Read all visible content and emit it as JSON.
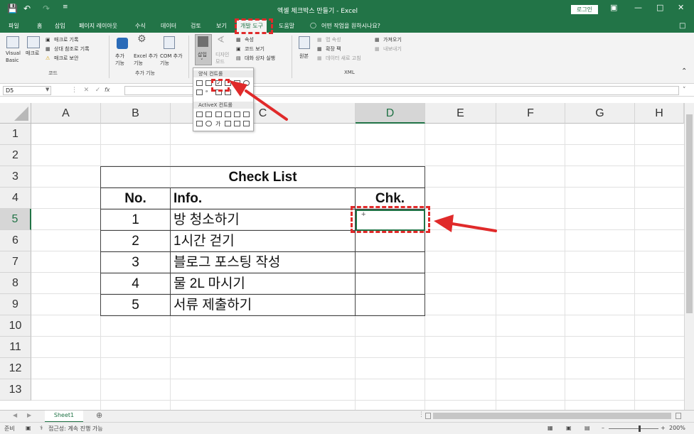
{
  "title_bar": {
    "title": "엑셀 체크박스 만들기 - Excel",
    "login_label": "로그인",
    "save_icon": "save-icon",
    "undo_icon": "undo-icon",
    "redo_icon": "redo-icon"
  },
  "tabs": [
    "파일",
    "홈",
    "삽입",
    "페이지 레이아웃",
    "수식",
    "데이터",
    "검토",
    "보기",
    "개발 도구",
    "도움말"
  ],
  "active_tab": "개발 도구",
  "tell_me": "어떤 작업을 원하시나요?",
  "ribbon": {
    "code": {
      "visual_basic": "Visual Basic",
      "macro": "매크로",
      "record_macro": "매크로 기록",
      "relative_ref": "상대 참조로 기록",
      "macro_security": "매크로 보안",
      "group_label": "코드"
    },
    "addins": {
      "addins": "추가 기능",
      "excel_addins": "Excel 추가 기능",
      "com_addins": "COM 추가 기능",
      "group_label": "추가 기능"
    },
    "controls": {
      "insert": "삽입",
      "design_mode": "디자인 모드",
      "properties": "속성",
      "view_code": "코드 보기",
      "run_dialog": "대화 상자 실행"
    },
    "xml": {
      "source": "원본",
      "map_properties": "맵 속성",
      "expansion_packs": "확장 팩",
      "refresh_data": "데이터 새로 고침",
      "import": "가져오기",
      "export": "내보내기",
      "group_label": "XML"
    }
  },
  "dropdown": {
    "form_controls_label": "양식 컨트롤",
    "activex_label": "ActiveX 컨트롤"
  },
  "formula_bar": {
    "name_box": "D5",
    "fx": "fx",
    "content": ""
  },
  "sheet": {
    "columns": [
      "A",
      "B",
      "C",
      "D",
      "E",
      "F",
      "G",
      "H"
    ],
    "selected_column": "D",
    "rows": [
      "1",
      "2",
      "3",
      "4",
      "5",
      "6",
      "7",
      "8",
      "9",
      "10",
      "11",
      "12",
      "13"
    ],
    "selected_row": "5"
  },
  "check_table": {
    "title": "Check List",
    "headers": [
      "No.",
      "Info.",
      "Chk."
    ],
    "rows": [
      {
        "no": "1",
        "info": "방 청소하기"
      },
      {
        "no": "2",
        "info": "1시간 걷기"
      },
      {
        "no": "3",
        "info": "블로그 포스팅 작성"
      },
      {
        "no": "4",
        "info": "물 2L 마시기"
      },
      {
        "no": "5",
        "info": "서류 제출하기"
      }
    ],
    "cursor_glyph": "+"
  },
  "sheet_tabs": {
    "active": "Sheet1"
  },
  "status_bar": {
    "mode": "준비",
    "accessibility": "접근성: 계속 진행 가능",
    "zoom": "200%"
  },
  "annotation_color": "#e02a2a",
  "excel_green": "#227447"
}
